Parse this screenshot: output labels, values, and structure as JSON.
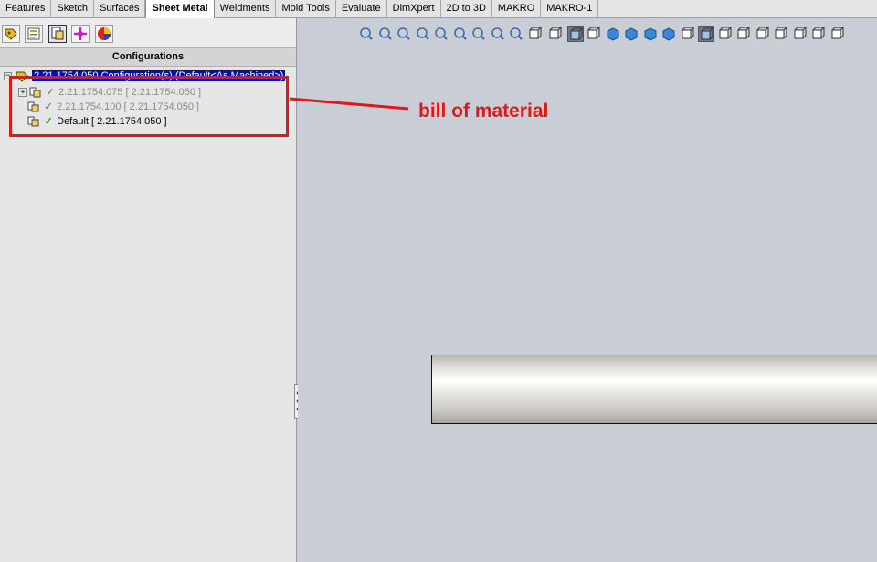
{
  "tabs": [
    "Features",
    "Sketch",
    "Surfaces",
    "Sheet Metal",
    "Weldments",
    "Mold Tools",
    "Evaluate",
    "DimXpert",
    "2D to 3D",
    "MAKRO",
    "MAKRO-1"
  ],
  "active_tab": "Sheet Metal",
  "panel": {
    "header": "Configurations",
    "root_label": "2.21.1754.050 Configuration(s)  (Default<As Machined>)",
    "children": [
      {
        "name": "2.21.1754.075<As Machined>",
        "suffix": "[ 2.21.1754.050 ]",
        "active": false
      },
      {
        "name": "2.21.1754.100<As Machined>",
        "suffix": "[ 2.21.1754.050 ]",
        "active": false
      },
      {
        "name": "Default<As Machined>",
        "suffix": "[ 2.21.1754.050 ]",
        "active": true
      }
    ]
  },
  "annotation": {
    "text": "bill of material",
    "color": "#e01818"
  },
  "colors": {
    "selection": "#0a0ab8",
    "viewport_bg": "#c9cdd6",
    "check_active": "#2a9a2a"
  }
}
